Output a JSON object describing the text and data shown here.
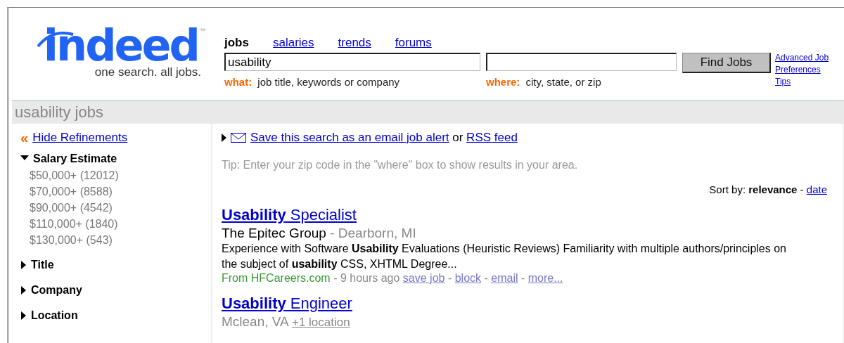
{
  "logo": {
    "wordmark": "indeed",
    "tm": "™",
    "tagline": "one search. all jobs."
  },
  "nav": [
    {
      "label": "jobs",
      "selected": true
    },
    {
      "label": "salaries",
      "selected": false
    },
    {
      "label": "trends",
      "selected": false
    },
    {
      "label": "forums",
      "selected": false
    }
  ],
  "what": {
    "label": "what:",
    "value": "usability",
    "hint": "job title, keywords or company"
  },
  "where": {
    "label": "where:",
    "hint": "city, state, or zip"
  },
  "find_button": "Find Jobs",
  "side_links": [
    "Advanced Job",
    "Preferences",
    "Tips"
  ],
  "heading": "usability jobs",
  "sidebar": {
    "hide_icon": "«",
    "hide_label": "Hide Refinements",
    "sections": [
      {
        "title": "Salary Estimate",
        "expanded": true,
        "items": [
          "$50,000+ (12012)",
          "$70,000+ (8588)",
          "$90,000+ (4542)",
          "$110,000+ (1840)",
          "$130,000+ (543)"
        ]
      },
      {
        "title": "Title",
        "expanded": false
      },
      {
        "title": "Company",
        "expanded": false
      },
      {
        "title": "Location",
        "expanded": false
      }
    ]
  },
  "alert": {
    "link": "Save this search as an email job alert",
    "joiner": "or",
    "rss": "RSS feed"
  },
  "tip": "Tip: Enter your zip code in the \"where\" box to show results in your area.",
  "sort": {
    "label": "Sort by:",
    "separator": "-",
    "options": [
      {
        "label": "relevance",
        "selected": true
      },
      {
        "label": "date",
        "selected": false
      }
    ]
  },
  "results": [
    {
      "title": "**Usability** Specialist",
      "company": "The Epitec Group",
      "separator": "-",
      "location": "Dearborn, MI",
      "snippet": "Experience with Software **Usability** Evaluations (Heuristic Reviews) Familiarity with multiple authors/principles on the subject of **usability** CSS, XHTML Degree...",
      "source": "From HFCareers.com",
      "age": "9 hours ago",
      "actions": [
        "save job",
        "block",
        "email",
        "more..."
      ]
    },
    {
      "title": "**Usability** Engineer",
      "location": "Mclean, VA",
      "extra": "+1 location"
    }
  ]
}
